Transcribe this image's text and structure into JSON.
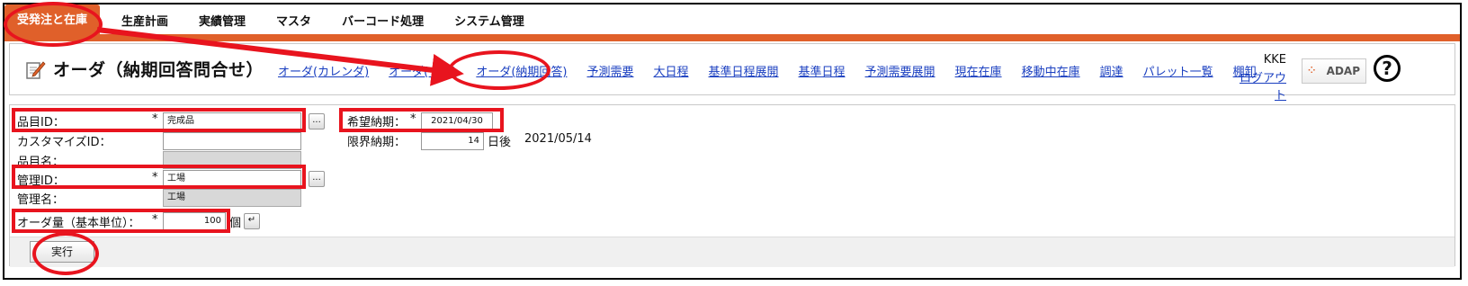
{
  "menu": {
    "items": [
      "受発注と在庫",
      "生産計画",
      "実績管理",
      "マスタ",
      "バーコード処理",
      "システム管理"
    ]
  },
  "header": {
    "title": "オーダ（納期回答問合せ）",
    "links": [
      "オーダ(カレンダ)",
      "オーダ(一覧)",
      "オーダ(納期回答)",
      "予測需要",
      "大日程",
      "基準日程展開",
      "基準日程",
      "予測需要展開",
      "現在在庫",
      "移動中在庫",
      "調達",
      "パレット一覧",
      "棚卸"
    ],
    "user": "KKE",
    "logout": "ログアウト",
    "logo_text": "ADAP",
    "help": "?"
  },
  "form": {
    "item_id_label": "品目ID：",
    "item_id_value": "完成品",
    "customize_id_label": "カスタマイズID：",
    "customize_id_value": "",
    "item_name_label": "品目名：",
    "item_name_value": "",
    "mgmt_id_label": "管理ID：",
    "mgmt_id_value": "工場",
    "mgmt_name_label": "管理名：",
    "mgmt_name_value": "工場",
    "order_qty_label": "オーダ量（基本単位）：",
    "order_qty_value": "100",
    "order_qty_unit": "個",
    "required_mark": "*",
    "lookup_button": "...",
    "enter_button": "↵",
    "desired_date_label": "希望納期：",
    "desired_date_value": "2021/04/30",
    "limit_date_label": "限界納期：",
    "limit_days_value": "14",
    "limit_days_suffix": "日後",
    "limit_date_result": "2021/05/14",
    "run_button": "実行"
  },
  "colors": {
    "accent_orange": "#e0602a",
    "link_blue": "#1a3fc0",
    "annotation_red": "#e8141e"
  }
}
